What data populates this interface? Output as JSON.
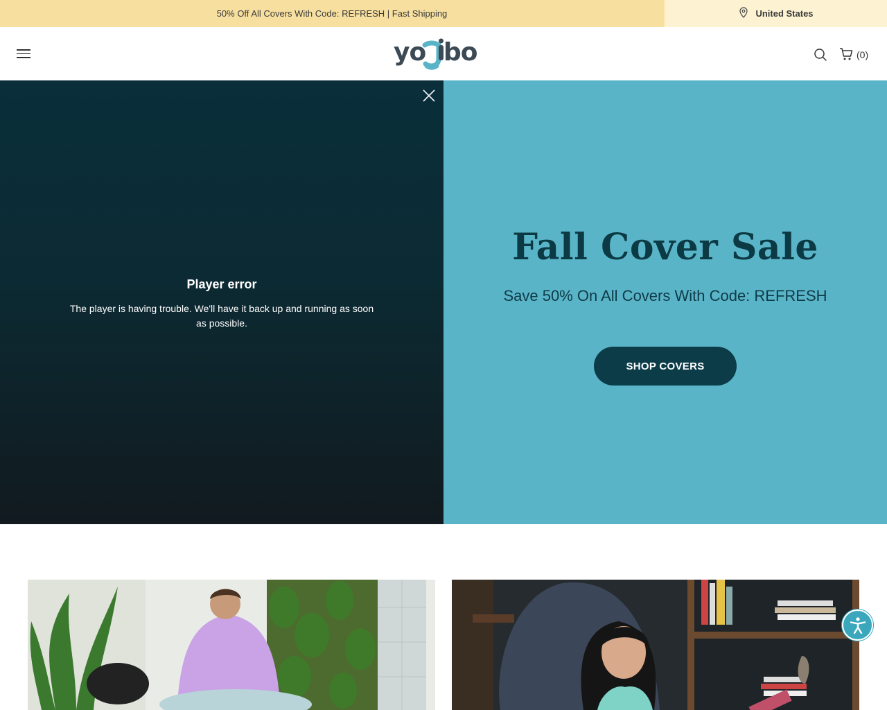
{
  "announcement": {
    "message": "50% Off All Covers With Code: REFRESH | Fast Shipping",
    "region": "United States",
    "region_icon": "location-pin-icon"
  },
  "header": {
    "menu_icon": "hamburger-menu-icon",
    "logo_text": "yogibo",
    "search_icon": "search-icon",
    "cart_icon": "cart-icon",
    "cart_count": "(0)"
  },
  "video": {
    "close_icon": "close-icon",
    "error_title": "Player error",
    "error_message": "The player is having trouble. We'll have it back up and running as soon as possible."
  },
  "promo": {
    "title": "Fall Cover Sale",
    "subtitle": "Save 50% On All Covers With Code: REFRESH",
    "button_label": "SHOP COVERS",
    "background_color": "#5ab4c8",
    "button_color": "#0b3c48"
  },
  "tiles": [
    {
      "image": "man-in-purple-hoodie-with-plants"
    },
    {
      "image": "woman-on-dark-bean-bag-with-bookshelf"
    }
  ],
  "accessibility": {
    "icon": "accessibility-icon"
  }
}
